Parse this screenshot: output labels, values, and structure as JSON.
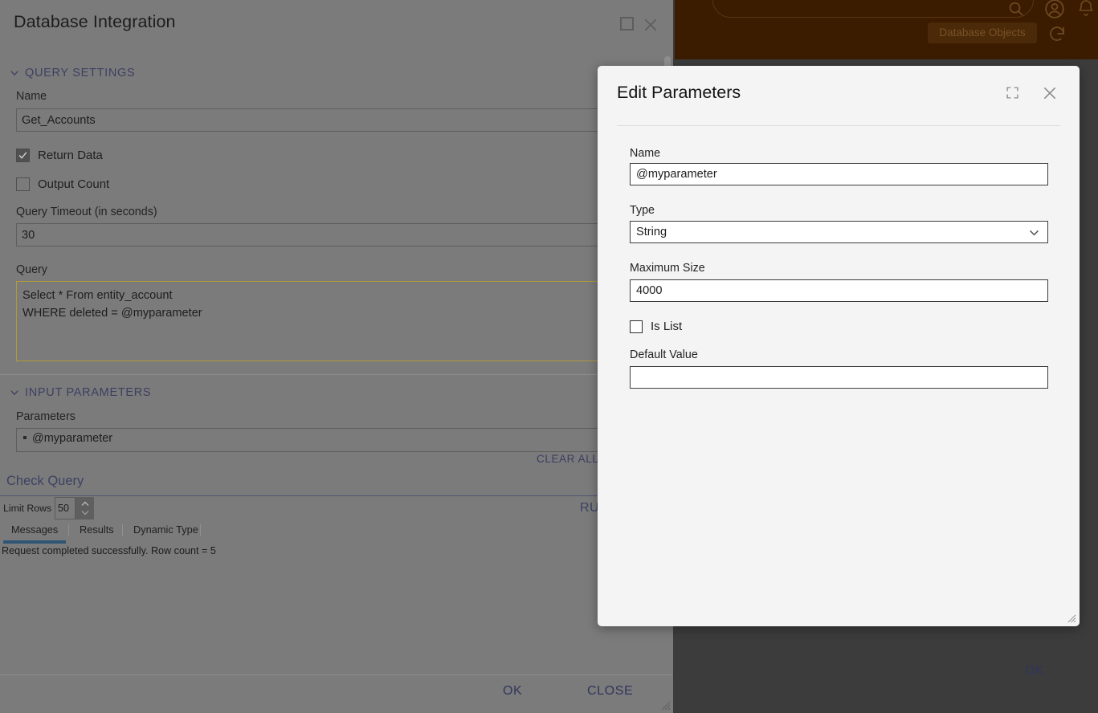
{
  "background_app": {
    "search": {
      "placeholder": "",
      "icon": "search-icon"
    },
    "account_icon": "account-circle-icon",
    "notifications_icon": "bell-icon",
    "database_objects_button": "Database Objects",
    "refresh_icon": "refresh-icon",
    "overflow_icon": "kebab-menu-icon"
  },
  "window": {
    "title": "Database Integration",
    "maximize_icon": "maximize-icon",
    "close_icon": "close-icon",
    "sections": {
      "query_settings": {
        "label": "QUERY SETTINGS",
        "chevron": "chevron-down-icon"
      },
      "input_parameters": {
        "label": "INPUT PARAMETERS",
        "chevron": "chevron-down-icon"
      }
    },
    "fields": {
      "name_label": "Name",
      "name_value": "Get_Accounts",
      "return_data_label": "Return Data",
      "return_data_checked": true,
      "output_count_label": "Output Count",
      "output_count_checked": false,
      "timeout_label": "Query Timeout (in seconds)",
      "timeout_value": "30",
      "query_label": "Query",
      "query_value": "Select * From entity_account\nWHERE deleted = @myparameter",
      "parameters_label": "Parameters",
      "parameter_items": [
        "@myparameter"
      ],
      "clear_all_label": "CLEAR ALL"
    },
    "check_query": {
      "title": "Check Query",
      "limit_rows_label": "Limit Rows",
      "limit_rows_value": "50",
      "run_label": "RUN",
      "spinner_up_icon": "chevron-up-icon",
      "spinner_down_icon": "chevron-down-icon"
    },
    "tabs": [
      {
        "label": "Messages",
        "active": true
      },
      {
        "label": "Results",
        "active": false
      },
      {
        "label": "Dynamic Type",
        "active": false
      }
    ],
    "message": "Request completed successfully. Row count = 5",
    "footer": {
      "ok_label": "OK",
      "close_label": "CLOSE",
      "resize_icon": "resize-grip-icon"
    }
  },
  "modal": {
    "title": "Edit Parameters",
    "expand_icon": "expand-icon",
    "close_icon": "close-icon",
    "name_label": "Name",
    "name_value": "@myparameter",
    "type_label": "Type",
    "type_value": "String",
    "type_chevron": "chevron-down-icon",
    "max_size_label": "Maximum Size",
    "max_size_value": "4000",
    "is_list_label": "Is List",
    "is_list_checked": false,
    "default_value_label": "Default Value",
    "default_value": "",
    "ok_label": "OK",
    "resize_icon": "resize-grip-icon"
  },
  "colors": {
    "overlay_gray": "#7b7b7b",
    "dark_chrome": "#3c3c3c",
    "brand_orange": "#3b1c00",
    "link_blue": "#31355c",
    "section_blue": "#3d3f63",
    "query_border_gold": "#b09a3a",
    "tab_active_underline": "#2f5575",
    "modal_bg": "#f4f4f4"
  }
}
